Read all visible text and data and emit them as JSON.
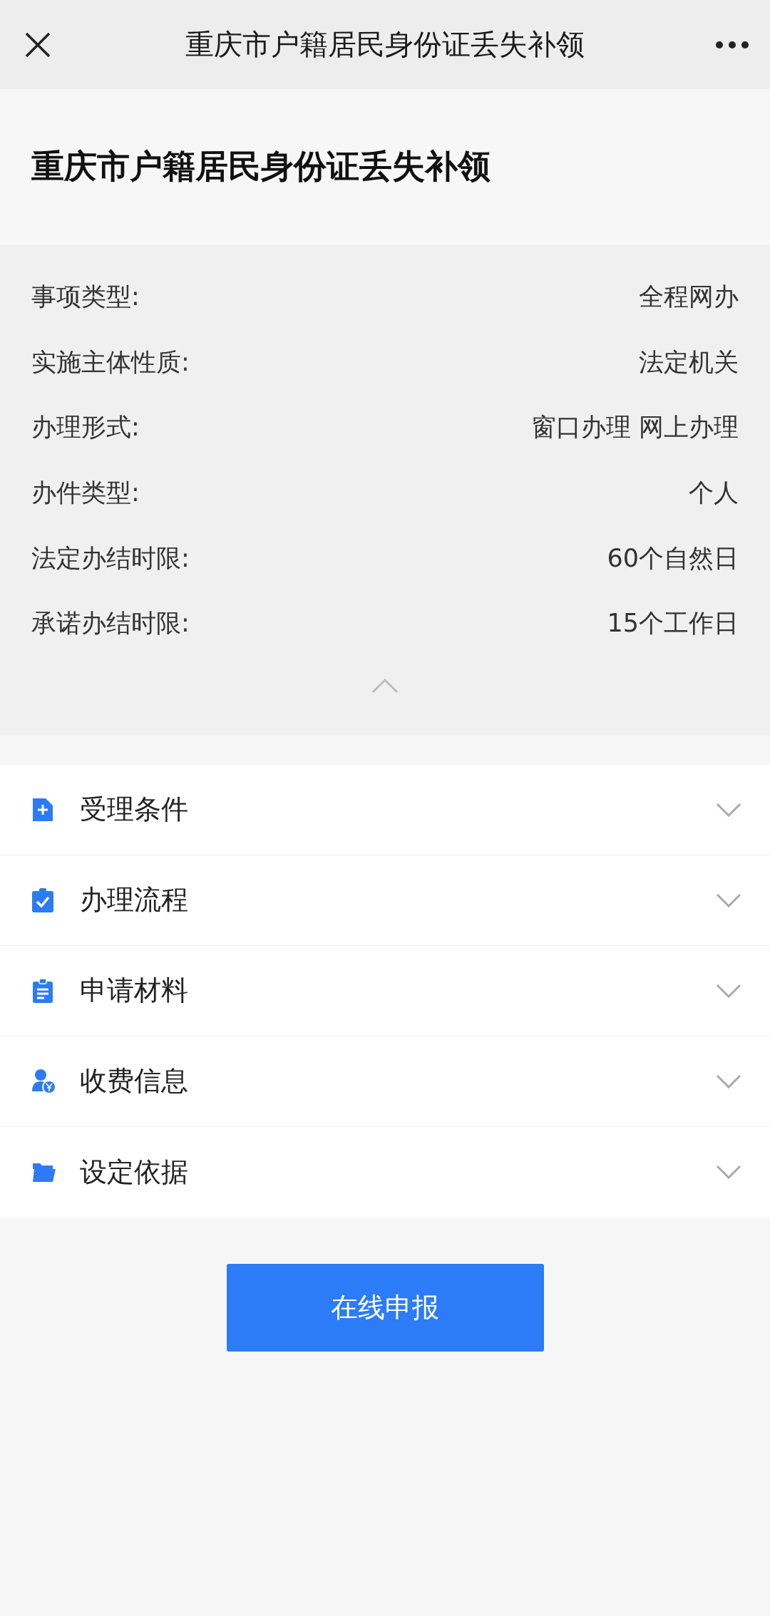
{
  "top_bar": {
    "title": "重庆市户籍居民身份证丢失补领"
  },
  "heading": "重庆市户籍居民身份证丢失补领",
  "details": {
    "expanded": true,
    "rows": [
      {
        "label": "事项类型:",
        "value": "全程网办"
      },
      {
        "label": "实施主体性质:",
        "value": "法定机关"
      },
      {
        "label": "办理形式:",
        "value": "窗口办理 网上办理"
      },
      {
        "label": "办件类型:",
        "value": "个人"
      },
      {
        "label": "法定办结时限:",
        "value": "60个自然日"
      },
      {
        "label": "承诺办结时限:",
        "value": "15个工作日"
      }
    ]
  },
  "sections": [
    {
      "kind": "conditions",
      "label": "受理条件",
      "expanded": false
    },
    {
      "kind": "process",
      "label": "办理流程",
      "expanded": false
    },
    {
      "kind": "materials",
      "label": "申请材料",
      "expanded": false
    },
    {
      "kind": "fees",
      "label": "收费信息",
      "expanded": false
    },
    {
      "kind": "basis",
      "label": "设定依据",
      "expanded": false
    }
  ],
  "submit_button": "在线申报"
}
